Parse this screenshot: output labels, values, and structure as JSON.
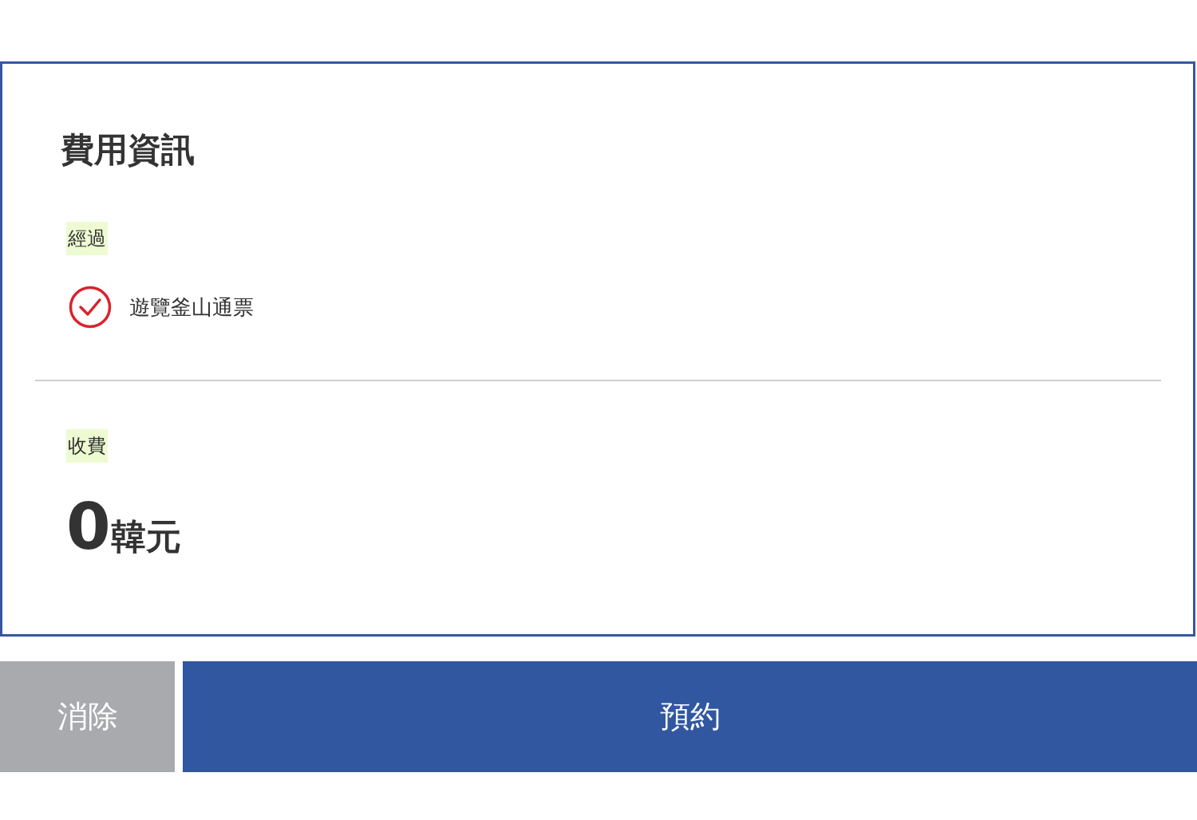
{
  "title": "費用資訊",
  "route": {
    "label": "經過",
    "items": [
      {
        "name": "遊覽釜山通票",
        "checked": true
      }
    ]
  },
  "fee": {
    "label": "收費",
    "amount": "0",
    "unit": "韓元"
  },
  "buttons": [
    {
      "kind": "cancel",
      "label": "消除"
    },
    {
      "kind": "primary",
      "label": "預約"
    }
  ]
}
